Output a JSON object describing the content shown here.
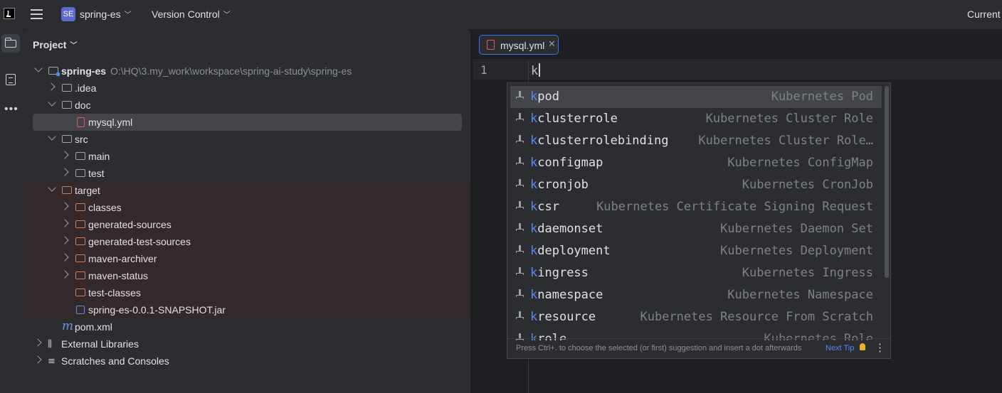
{
  "topbar": {
    "project_badge": "SE",
    "project_name": "spring-es",
    "vcs_label": "Version Control",
    "right_label": "Current"
  },
  "project_panel": {
    "title": "Project",
    "tree": [
      {
        "label": "spring-es",
        "path": "O:\\HQ\\3.my_work\\workspace\\spring-ai-study\\spring-es"
      },
      {
        "label": ".idea"
      },
      {
        "label": "doc"
      },
      {
        "label": "mysql.yml"
      },
      {
        "label": "src"
      },
      {
        "label": "main"
      },
      {
        "label": "test"
      },
      {
        "label": "target"
      },
      {
        "label": "classes"
      },
      {
        "label": "generated-sources"
      },
      {
        "label": "generated-test-sources"
      },
      {
        "label": "maven-archiver"
      },
      {
        "label": "maven-status"
      },
      {
        "label": "test-classes"
      },
      {
        "label": "spring-es-0.0.1-SNAPSHOT.jar"
      },
      {
        "label": "pom.xml"
      },
      {
        "label": "External Libraries"
      },
      {
        "label": "Scratches and Consoles"
      }
    ]
  },
  "editor": {
    "tab_label": "mysql.yml",
    "line_number": "1",
    "code_text": "k"
  },
  "completion": {
    "typed_prefix": "k",
    "items": [
      {
        "rest": "pod",
        "desc": "Kubernetes Pod"
      },
      {
        "rest": "clusterrole",
        "desc": "Kubernetes Cluster Role"
      },
      {
        "rest": "clusterrolebinding",
        "desc": "Kubernetes Cluster Role…"
      },
      {
        "rest": "configmap",
        "desc": "Kubernetes ConfigMap"
      },
      {
        "rest": "cronjob",
        "desc": "Kubernetes CronJob"
      },
      {
        "rest": "csr",
        "desc": "Kubernetes Certificate Signing Request"
      },
      {
        "rest": "daemonset",
        "desc": "Kubernetes Daemon Set"
      },
      {
        "rest": "deployment",
        "desc": "Kubernetes Deployment"
      },
      {
        "rest": "ingress",
        "desc": "Kubernetes Ingress"
      },
      {
        "rest": "namespace",
        "desc": "Kubernetes Namespace"
      },
      {
        "rest": "resource",
        "desc": "Kubernetes Resource From Scratch"
      },
      {
        "rest": "role",
        "desc": "Kubernetes Role"
      }
    ],
    "footer_text": "Press Ctrl+. to choose the selected (or first) suggestion and insert a dot afterwards",
    "next_tip": "Next Tip"
  },
  "icons": {
    "logo": "ide-logo-icon",
    "menu": "hamburger-menu-icon",
    "project_tool": "folder-icon",
    "structure_tool": "structure-icon",
    "more": "more-dots-icon"
  },
  "colors": {
    "accent": "#3574f0",
    "match_highlight": "#548af7",
    "target_folder": "#c7805a",
    "yaml_file": "#e55765",
    "project_badge": "#5c6bd1"
  }
}
